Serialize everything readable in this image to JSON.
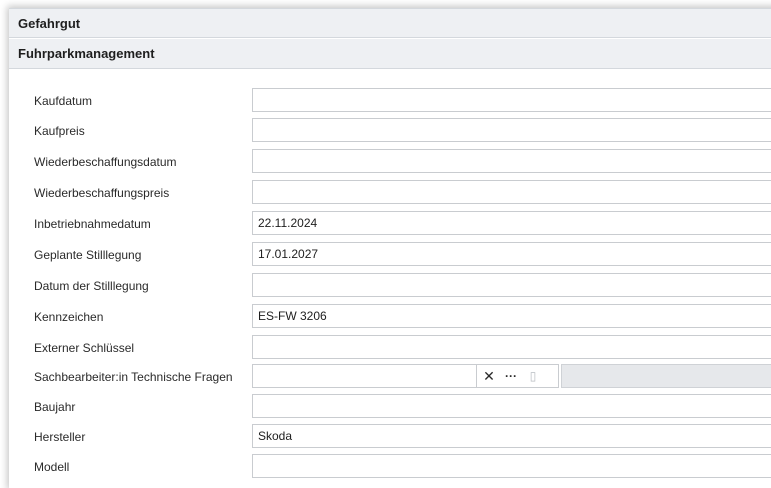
{
  "sections": {
    "gefahrgut": "Gefahrgut",
    "fuhrpark": "Fuhrparkmanagement"
  },
  "fields": [
    {
      "label": "Kaufdatum",
      "value": ""
    },
    {
      "label": "Kaufpreis",
      "value": ""
    },
    {
      "label": "Wiederbeschaffungsdatum",
      "value": ""
    },
    {
      "label": "Wiederbeschaffungspreis",
      "value": ""
    },
    {
      "label": "Inbetriebnahmedatum",
      "value": "22.11.2024"
    },
    {
      "label": "Geplante Stilllegung",
      "value": "17.01.2027"
    },
    {
      "label": "Datum der Stilllegung",
      "value": ""
    },
    {
      "label": "Kennzeichen",
      "value": "ES-FW 3206"
    },
    {
      "label": "Externer Schlüssel",
      "value": ""
    },
    {
      "label": "Sachbearbeiter:in Technische Fragen",
      "value": ""
    },
    {
      "label": "Baujahr",
      "value": ""
    },
    {
      "label": "Hersteller",
      "value": "Skoda"
    },
    {
      "label": "Modell",
      "value": ""
    }
  ],
  "lookup_buttons": {
    "clear": "✕",
    "more": "···",
    "open": "▯"
  },
  "icons": {
    "clear": "close-icon",
    "more": "ellipsis-icon",
    "open": "open-record-icon"
  }
}
